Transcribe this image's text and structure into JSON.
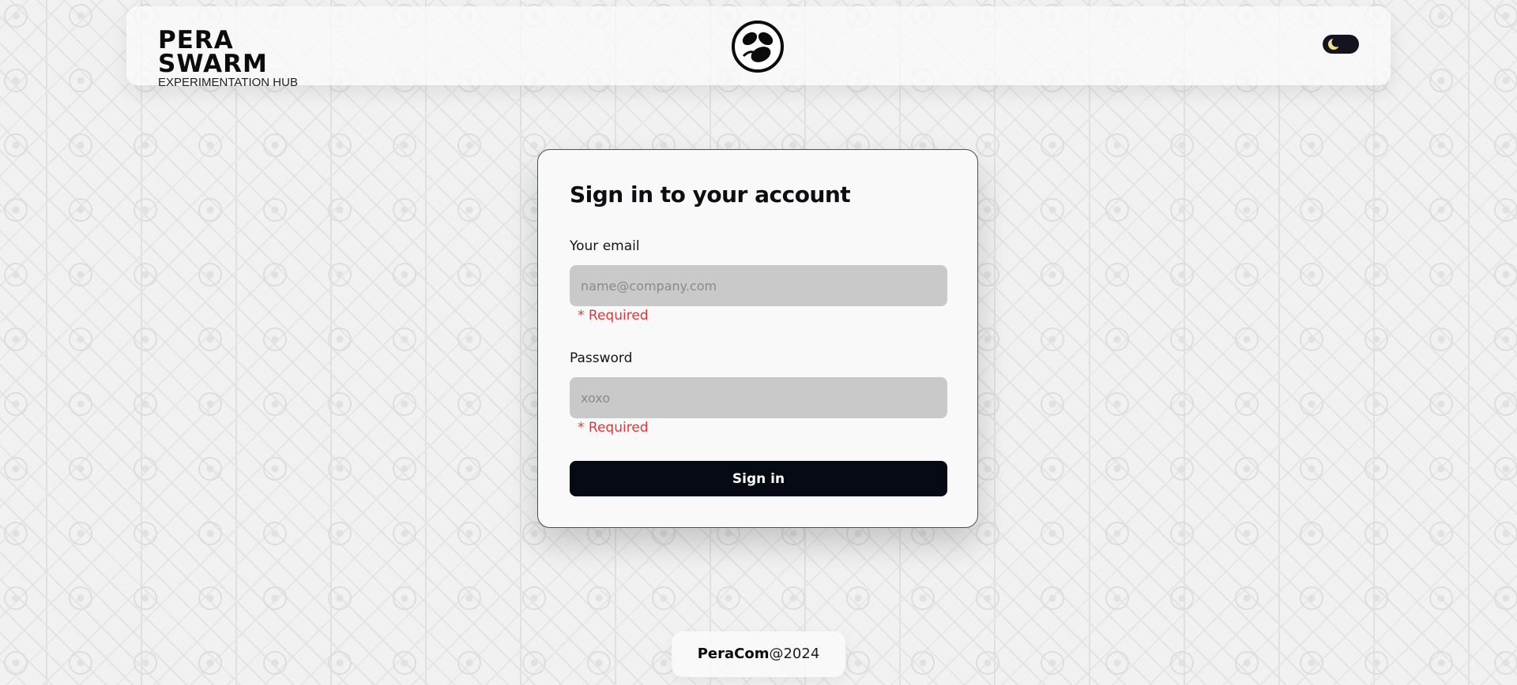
{
  "header": {
    "brand_title": "PERA SWARM",
    "brand_subtitle": "EXPERIMENTATION HUB",
    "emblem_icon": "swarm-emblem-icon",
    "theme_toggle_icon": "moon-icon"
  },
  "login": {
    "title": "Sign in to your account",
    "email_label": "Your email",
    "email_placeholder": "name@company.com",
    "email_value": "",
    "email_error": "* Required",
    "password_label": "Password",
    "password_placeholder": "xoxo",
    "password_value": "",
    "password_error": "* Required",
    "submit_label": "Sign in"
  },
  "footer": {
    "brand": "PeraCom",
    "suffix": "@2024"
  },
  "colors": {
    "primary_button": "#060a13",
    "error": "#e03838",
    "input_background": "#c9c9c9",
    "card_background": "#f9f9f9",
    "toggle_moon": "#f5e08a"
  }
}
